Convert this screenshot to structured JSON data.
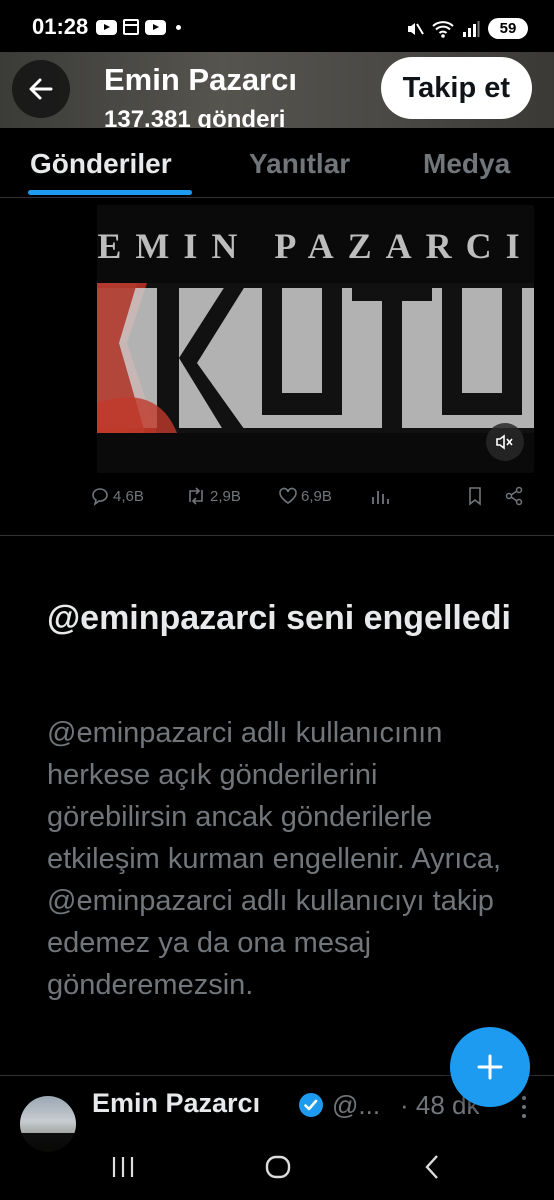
{
  "status_bar": {
    "time": "01:28",
    "battery": "59"
  },
  "header": {
    "name": "Emin Pazarcı",
    "subtitle": "137.381 gönderi",
    "follow_label": "Takip et"
  },
  "tabs": [
    {
      "label": "Gönderiler",
      "active": true
    },
    {
      "label": "Yanıtlar",
      "active": false
    },
    {
      "label": "Medya",
      "active": false
    }
  ],
  "media": {
    "top_text": "EMIN PAZARCI",
    "title_text": "KUTU"
  },
  "actions": {
    "replies": "4,6B",
    "reposts": "2,9B",
    "likes": "6,9B"
  },
  "blocked": {
    "title": "@eminpazarci seni engelledi",
    "body": "@eminpazarci adlı kullanıcının herkese açık gönderilerini görebilirsin ancak gönderilerle etkileşim kurman engellenir. Ayrıca, @eminpazarci adlı kullanıcıyı takip edemez ya da ona mesaj gönderemezsin."
  },
  "bottom_tweet": {
    "name": "Emin Pazarcı",
    "handle": "@...",
    "time": "· 48 dk"
  },
  "colors": {
    "accent": "#1d9bf0",
    "background": "#000000",
    "muted": "#71767b"
  }
}
